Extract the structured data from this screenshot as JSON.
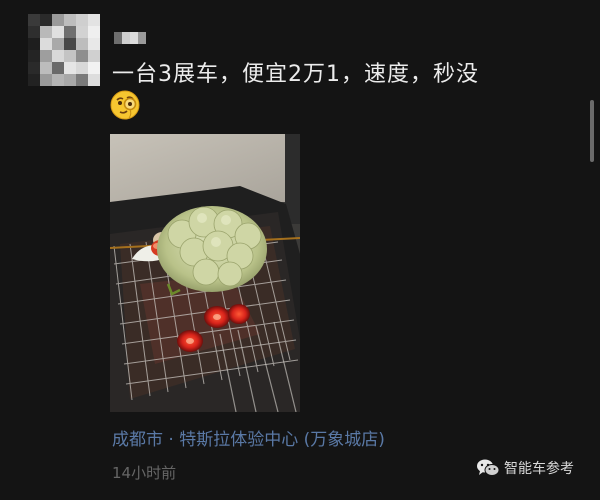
{
  "post": {
    "author_avatar": "pixelated-avatar",
    "author_name_hidden": true,
    "text": "一台3展车，便宜2万1，速度，秒没",
    "emoji": "face-with-monocle",
    "photo": "cauliflower-sheep-on-grill-photo",
    "location": "成都市 · 特斯拉体验中心 (万象城店)",
    "timestamp": "14小时前"
  },
  "watermark": {
    "icon": "wechat-icon",
    "label": "智能车参考"
  },
  "colors": {
    "background": "#141414",
    "text": "#ececec",
    "location": "#5a79a6",
    "timestamp": "#666666"
  }
}
